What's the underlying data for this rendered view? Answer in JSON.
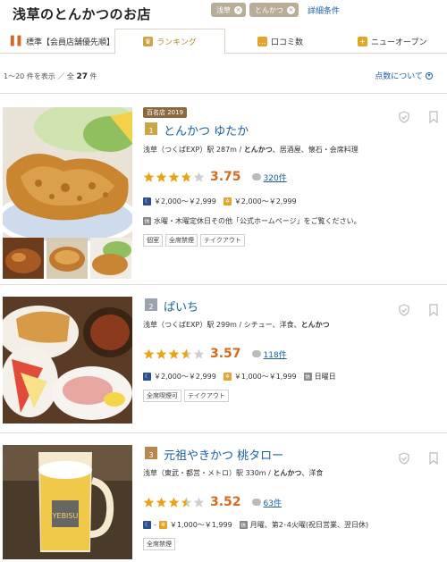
{
  "header": {
    "title": "浅草のとんかつのお店",
    "chips": [
      "浅草",
      "とんかつ"
    ],
    "more_conditions": "詳細条件"
  },
  "tabs": [
    {
      "label": "標準【会員店舗優先順】",
      "icon": "sort-bars-icon",
      "active": false
    },
    {
      "label": "ランキング",
      "icon": "crown-icon",
      "active": true
    },
    {
      "label": "口コミ数",
      "icon": "chat-icon",
      "active": false
    },
    {
      "label": "ニューオープン",
      "icon": "new-open-icon",
      "active": false
    }
  ],
  "results": {
    "range": "1〜20",
    "range_suffix": "件を表示 ／ 全",
    "total": "27",
    "total_suffix": "件",
    "about_points": "点数について"
  },
  "restaurants": [
    {
      "award": "百名店 2019",
      "rank": "1",
      "name": "とんかつ ゆたか",
      "location": "浅草（つくばEXP）駅 287m",
      "genre_bold": "とんかつ",
      "genre_rest": "、居酒屋、懐石・会席料理",
      "score": "3.75",
      "stars": 3.75,
      "reviews": "320件",
      "price_night": "￥2,000〜￥2,999",
      "price_day": "￥2,000〜￥2,999",
      "holiday": "水曜・木曜定休日その他「公式ホームページ」をご覧ください。",
      "tags": [
        "個室",
        "全席禁煙",
        "テイクアウト"
      ]
    },
    {
      "award": "",
      "rank": "2",
      "name": "ぱいち",
      "location": "浅草（つくばEXP）駅 299m",
      "genre_pre": "シチュー、洋食、",
      "genre_bold": "とんかつ",
      "score": "3.57",
      "stars": 3.57,
      "reviews": "118件",
      "price_night": "￥2,000〜￥2,999",
      "price_day": "￥1,000〜￥1,999",
      "holiday": "日曜日",
      "tags": [
        "全席喫煙可",
        "テイクアウト"
      ]
    },
    {
      "award": "",
      "rank": "3",
      "name": "元祖やきかつ 桃タロー",
      "location": "浅草（東武・都営・メトロ）駅 330m",
      "genre_bold": "とんかつ",
      "genre_rest": "、洋食",
      "score": "3.52",
      "stars": 3.52,
      "reviews": "63件",
      "price_night": "-",
      "price_day": "￥1,000〜￥1,999",
      "holiday": "月曜、第2･4火曜(祝日営業、翌日休)",
      "tags": [
        "全席禁煙"
      ]
    }
  ],
  "colors": {
    "link": "#1a5fa7",
    "score": "#d56b1e",
    "star": "#e8a317",
    "award_bg": "#8c6a3f",
    "chip_bg": "#b8ad97"
  }
}
